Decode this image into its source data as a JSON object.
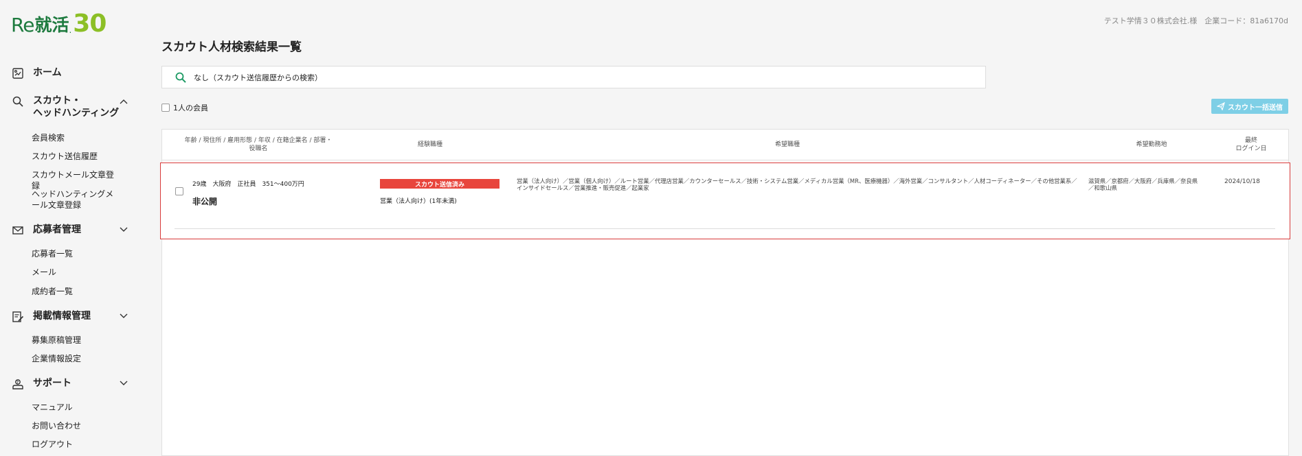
{
  "logo": {
    "re": "Re",
    "kana": "就活",
    "dot": ".",
    "num": "30"
  },
  "header": {
    "company": "テスト学情３０株式会社.様　企業コード：81a6170d"
  },
  "sidebar": {
    "home": "ホーム",
    "scout": {
      "label": "スカウト・\nヘッドハンティング",
      "items": [
        "会員検索",
        "スカウト送信履歴",
        "スカウトメール文章登録",
        "ヘッドハンティングメール文章登録"
      ]
    },
    "applicants": {
      "label": "応募者管理",
      "items": [
        "応募者一覧",
        "メール",
        "成約者一覧"
      ]
    },
    "postings": {
      "label": "掲載情報管理",
      "items": [
        "募集原稿管理",
        "企業情報設定"
      ]
    },
    "support": {
      "label": "サポート",
      "items": [
        "マニュアル",
        "お問い合わせ",
        "ログアウト"
      ]
    }
  },
  "main": {
    "title": "スカウト人材検索結果一覧",
    "search_text": "なし（スカウト送信履歴からの検索）",
    "member_check_label": "1人の会員",
    "bulk_send_label": "スカウト一括送信",
    "columns": {
      "profile": "年齢 / 現住所 / 雇用形態 / 年収 / 在籍企業名 / 部署・役職名",
      "experience": "経験職種",
      "desired_job": "希望職種",
      "desired_area": "希望勤務地",
      "last_login": "最終\nログイン日"
    },
    "rows": [
      {
        "summary": "29歳　大阪府　正社員　351〜400万円",
        "company": "非公開",
        "status_badge": "スカウト送信済み",
        "experience": "営業（法人向け）(1年未満)",
        "desired_jobs": "営業（法人向け）／営業（個人向け）／ルート営業／代理店営業／カウンターセールス／技術・システム営業／メディカル営業（MR、医療機器）／海外営業／コンサルタント／人材コーディネーター／その他営業系／インサイドセールス／営業推進・販売促進／起業家",
        "desired_areas": "滋賀県／京都府／大阪府／兵庫県／奈良県／和歌山県",
        "last_login": "2024/10/18"
      }
    ]
  },
  "colors": {
    "brand_green": "#1d7a3e",
    "brand_lime": "#8cbf26",
    "badge_red": "#e8453c",
    "button_blue": "#7ecfe6",
    "row_highlight": "#d83a3a"
  }
}
